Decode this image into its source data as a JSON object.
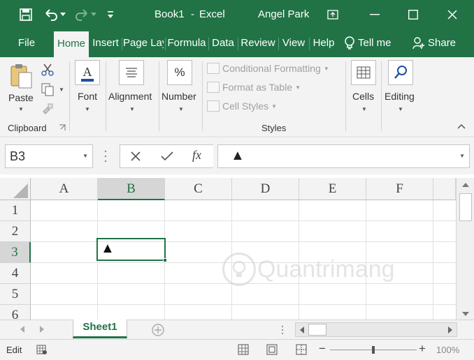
{
  "titlebar": {
    "book_title": "Book1",
    "separator": "-",
    "app_name": "Excel",
    "user_name": "Angel Park",
    "bg_color": "#217346"
  },
  "tabs": [
    {
      "label": "File",
      "active": false
    },
    {
      "label": "Home",
      "active": true
    },
    {
      "label": "Insert",
      "active": false
    },
    {
      "label": "Page Lay",
      "active": false
    },
    {
      "label": "Formula",
      "active": false
    },
    {
      "label": "Data",
      "active": false
    },
    {
      "label": "Review",
      "active": false
    },
    {
      "label": "View",
      "active": false
    },
    {
      "label": "Help",
      "active": false
    }
  ],
  "tellme": "Tell me",
  "share": "Share",
  "ribbon": {
    "paste": "Paste",
    "clipboard": "Clipboard",
    "font": "Font",
    "alignment": "Alignment",
    "number": "Number",
    "number_icon_glyph": "%",
    "conditional_formatting": "Conditional Formatting",
    "format_as_table": "Format as Table",
    "cell_styles": "Cell Styles",
    "styles": "Styles",
    "cells": "Cells",
    "editing": "Editing"
  },
  "formula_bar": {
    "name_box": "B3",
    "fx": "fx",
    "content": "▲"
  },
  "grid": {
    "columns": [
      "A",
      "B",
      "C",
      "D",
      "E",
      "F"
    ],
    "rows": [
      "1",
      "2",
      "3",
      "4",
      "5",
      "6"
    ],
    "selected_column": "B",
    "selected_row": "3",
    "active_cell_value": "▲"
  },
  "watermark": "Quantrimang",
  "sheet_tabs": [
    {
      "label": "Sheet1",
      "active": true
    }
  ],
  "status": {
    "mode": "Edit",
    "zoom": "100%"
  }
}
